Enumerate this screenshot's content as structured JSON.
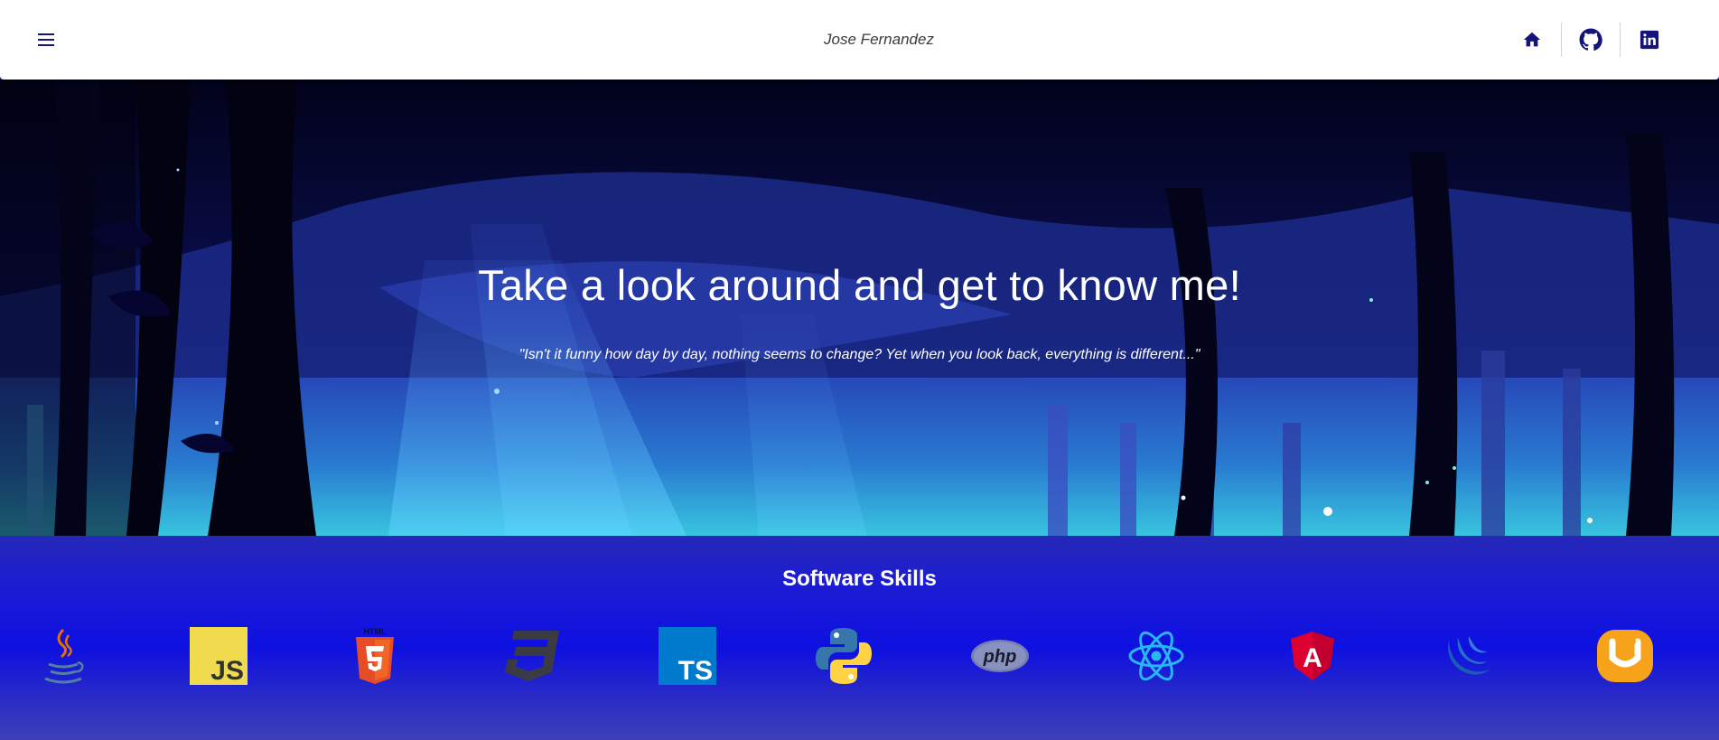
{
  "header": {
    "brand_name": "Jose Fernandez",
    "menu_icon": "menu-icon",
    "nav": [
      {
        "icon": "home-icon"
      },
      {
        "icon": "github-icon"
      },
      {
        "icon": "linkedin-icon"
      }
    ]
  },
  "hero": {
    "title": "Take a look around and get to know me!",
    "quote": "\"Isn't it funny how day by day, nothing seems to change? Yet when you look back, everything is different...\""
  },
  "skills": {
    "title": "Software Skills",
    "items": [
      {
        "icon": "java-icon"
      },
      {
        "icon": "javascript-icon",
        "text": "JS"
      },
      {
        "icon": "html5-icon",
        "text": "HTML"
      },
      {
        "icon": "css3-icon"
      },
      {
        "icon": "typescript-icon",
        "text": "TS"
      },
      {
        "icon": "python-icon"
      },
      {
        "icon": "php-icon",
        "text": "php"
      },
      {
        "icon": "react-icon"
      },
      {
        "icon": "angular-icon",
        "text": "A"
      },
      {
        "icon": "jquery-icon"
      },
      {
        "icon": "uikit-icon"
      }
    ]
  },
  "colors": {
    "nav_icon": "#14147a",
    "skills_band": "#0e10e0",
    "hero_text": "#ffffff"
  }
}
